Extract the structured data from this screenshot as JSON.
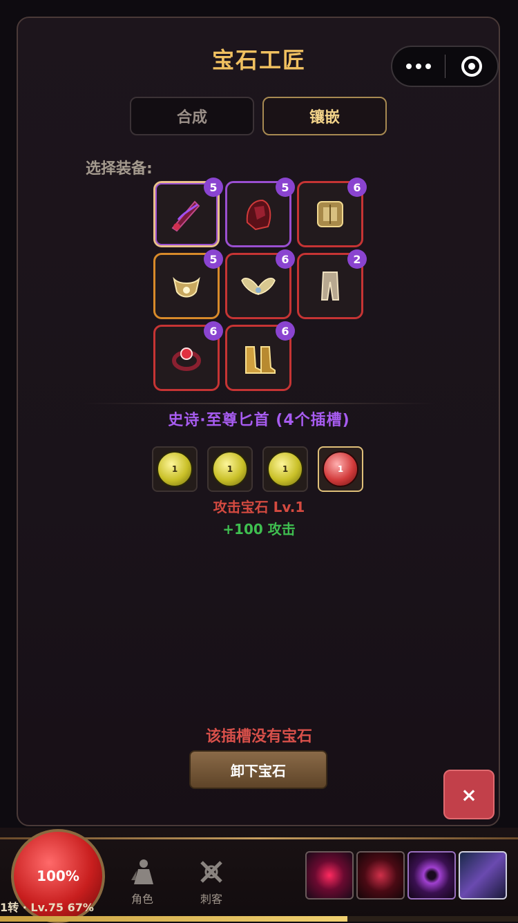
{
  "panel": {
    "title": "宝石工匠",
    "tabs": [
      {
        "label": "合成",
        "active": false
      },
      {
        "label": "镶嵌",
        "active": true
      }
    ],
    "select_label": "选择装备:",
    "equipment": [
      {
        "icon": "dagger-icon",
        "count": "5",
        "rarity": "purple",
        "selected": true
      },
      {
        "icon": "helmet-icon",
        "count": "5",
        "rarity": "purple",
        "selected": false
      },
      {
        "icon": "armor-icon",
        "count": "6",
        "rarity": "red",
        "selected": false
      },
      {
        "icon": "amulet-icon",
        "count": "5",
        "rarity": "orange",
        "selected": false
      },
      {
        "icon": "wings-icon",
        "count": "6",
        "rarity": "red",
        "selected": false
      },
      {
        "icon": "pants-icon",
        "count": "2",
        "rarity": "red",
        "selected": false
      },
      {
        "icon": "ring-icon",
        "count": "6",
        "rarity": "red",
        "selected": false
      },
      {
        "icon": "boots-icon",
        "count": "6",
        "rarity": "red",
        "selected": false
      }
    ],
    "item_name": "史诗·至尊匕首 (4个插槽)",
    "gem_slots": [
      {
        "type": "yellow",
        "level": "1"
      },
      {
        "type": "yellow",
        "level": "1"
      },
      {
        "type": "yellow",
        "level": "1"
      },
      {
        "type": "red",
        "level": "1",
        "selected": true
      }
    ],
    "gem_name": "攻击宝石 Lv.1",
    "gem_effect": "+100 攻击",
    "no_gem_text": "该插槽没有宝石",
    "unmount_label": "卸下宝石",
    "close_label": "×"
  },
  "bottom": {
    "hp_percent": "100%",
    "level_text": "1转 · Lv.75 67%",
    "xp_fraction": 0.67,
    "nav": [
      {
        "label": "角色",
        "icon": "character-icon"
      },
      {
        "label": "刺客",
        "icon": "crossed-swords-icon"
      }
    ],
    "skills": [
      "skill-burst-icon",
      "skill-slash-icon",
      "skill-vortex-icon",
      "skill-dash-icon"
    ]
  },
  "colors": {
    "accent_gold": "#f0c060",
    "purple": "#9a4fd1",
    "red": "#c63434",
    "orange": "#d88a2a",
    "gem_name": "#d44a40",
    "effect_green": "#3fbf50"
  }
}
